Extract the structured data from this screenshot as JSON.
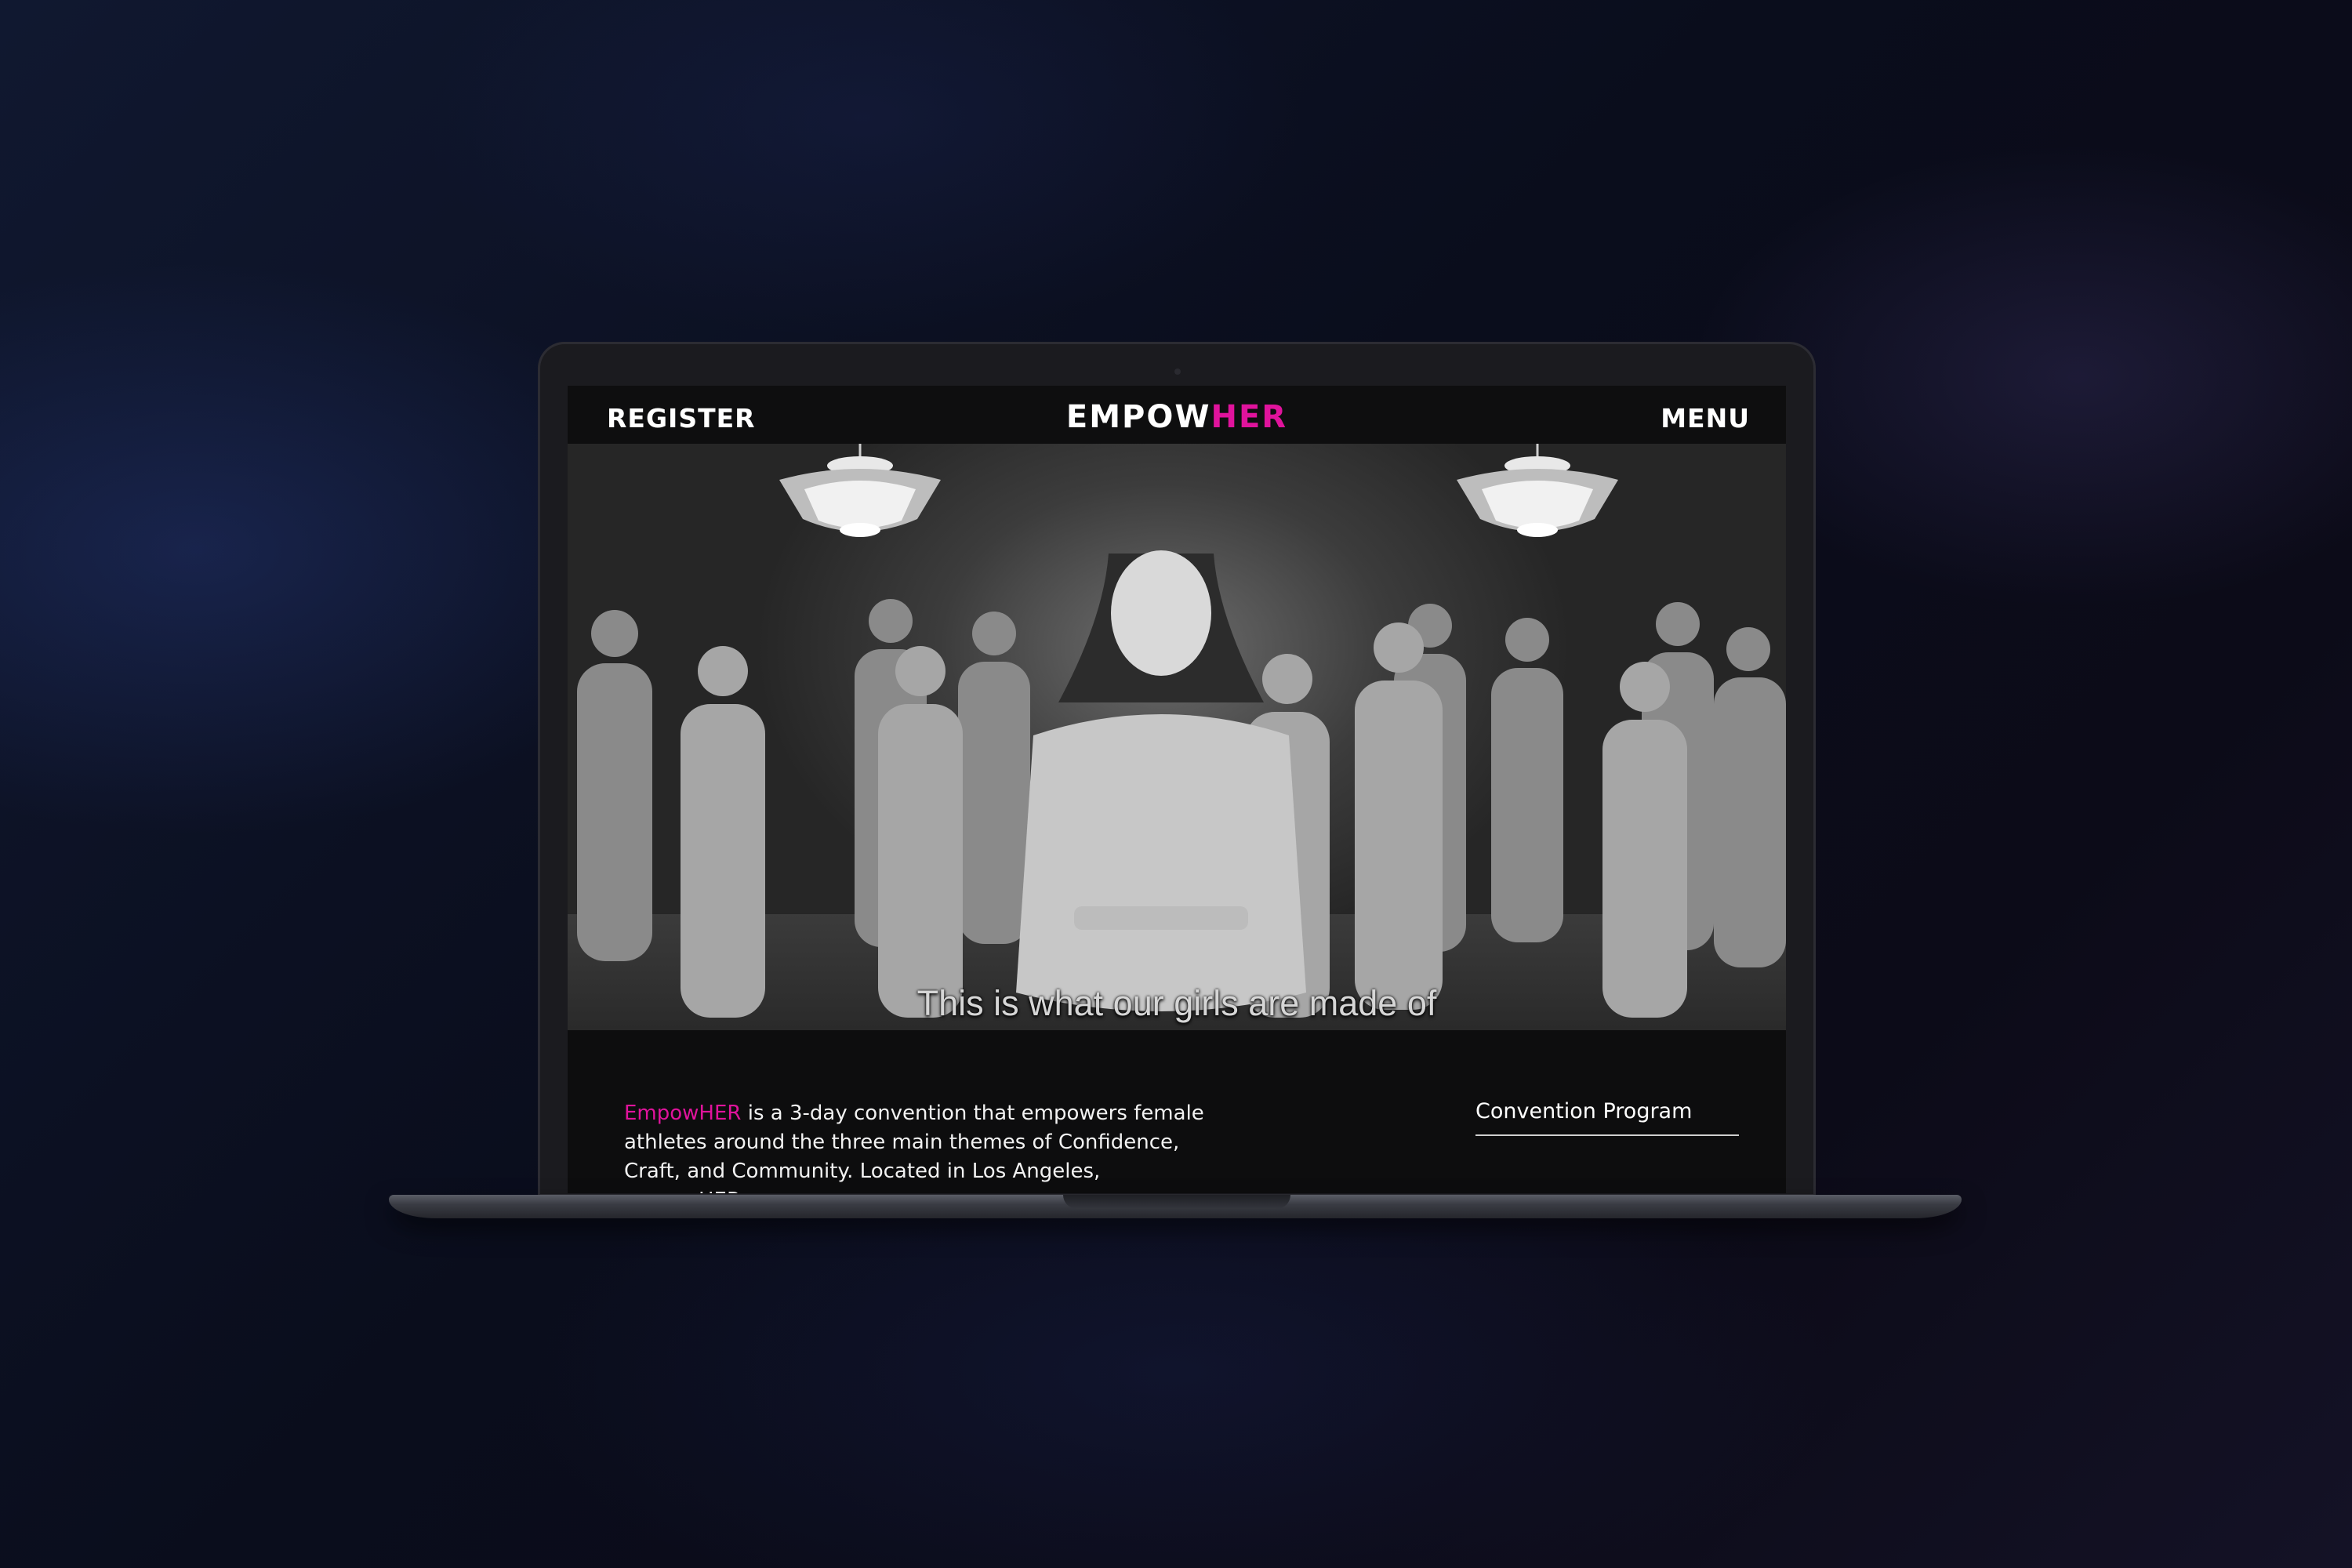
{
  "header": {
    "register_label": "REGISTER",
    "logo_prefix": "EMPOW",
    "logo_suffix": "HER",
    "menu_label": "MENU"
  },
  "video": {
    "subtitle": "This is what our girls are made of"
  },
  "intro": {
    "brand": "EmpowHER",
    "text": " is a 3-day convention that empowers female athletes around the three main themes of Confidence, Craft, and Community. Located in Los Angeles, empowHER was"
  },
  "program": {
    "label": "Convention Program"
  },
  "colors": {
    "accent": "#e0139c",
    "page_background": "#0d0d0e",
    "text": "#ffffff"
  },
  "icons": [
    "chandelier-icon",
    "camera-icon"
  ]
}
